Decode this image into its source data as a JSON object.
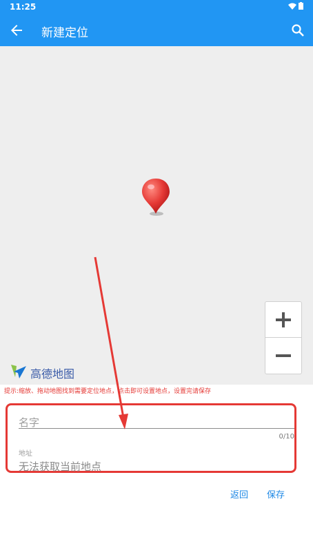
{
  "status_bar": {
    "time": "11:25"
  },
  "toolbar": {
    "title": "新建定位"
  },
  "map": {
    "logo_text": "高德地图",
    "zoom_in_label": "+",
    "zoom_out_label": "−"
  },
  "hint": "提示:缩放、拖动地图找到需要定位地点，点击即可设置地点，设置完请保存",
  "form": {
    "name_placeholder": "名字",
    "name_counter": "0/10",
    "address_label": "地址",
    "address_value": "无法获取当前地点"
  },
  "actions": {
    "back_label": "返回",
    "save_label": "保存"
  },
  "colors": {
    "primary": "#2196f3",
    "annotation": "#e53935"
  }
}
